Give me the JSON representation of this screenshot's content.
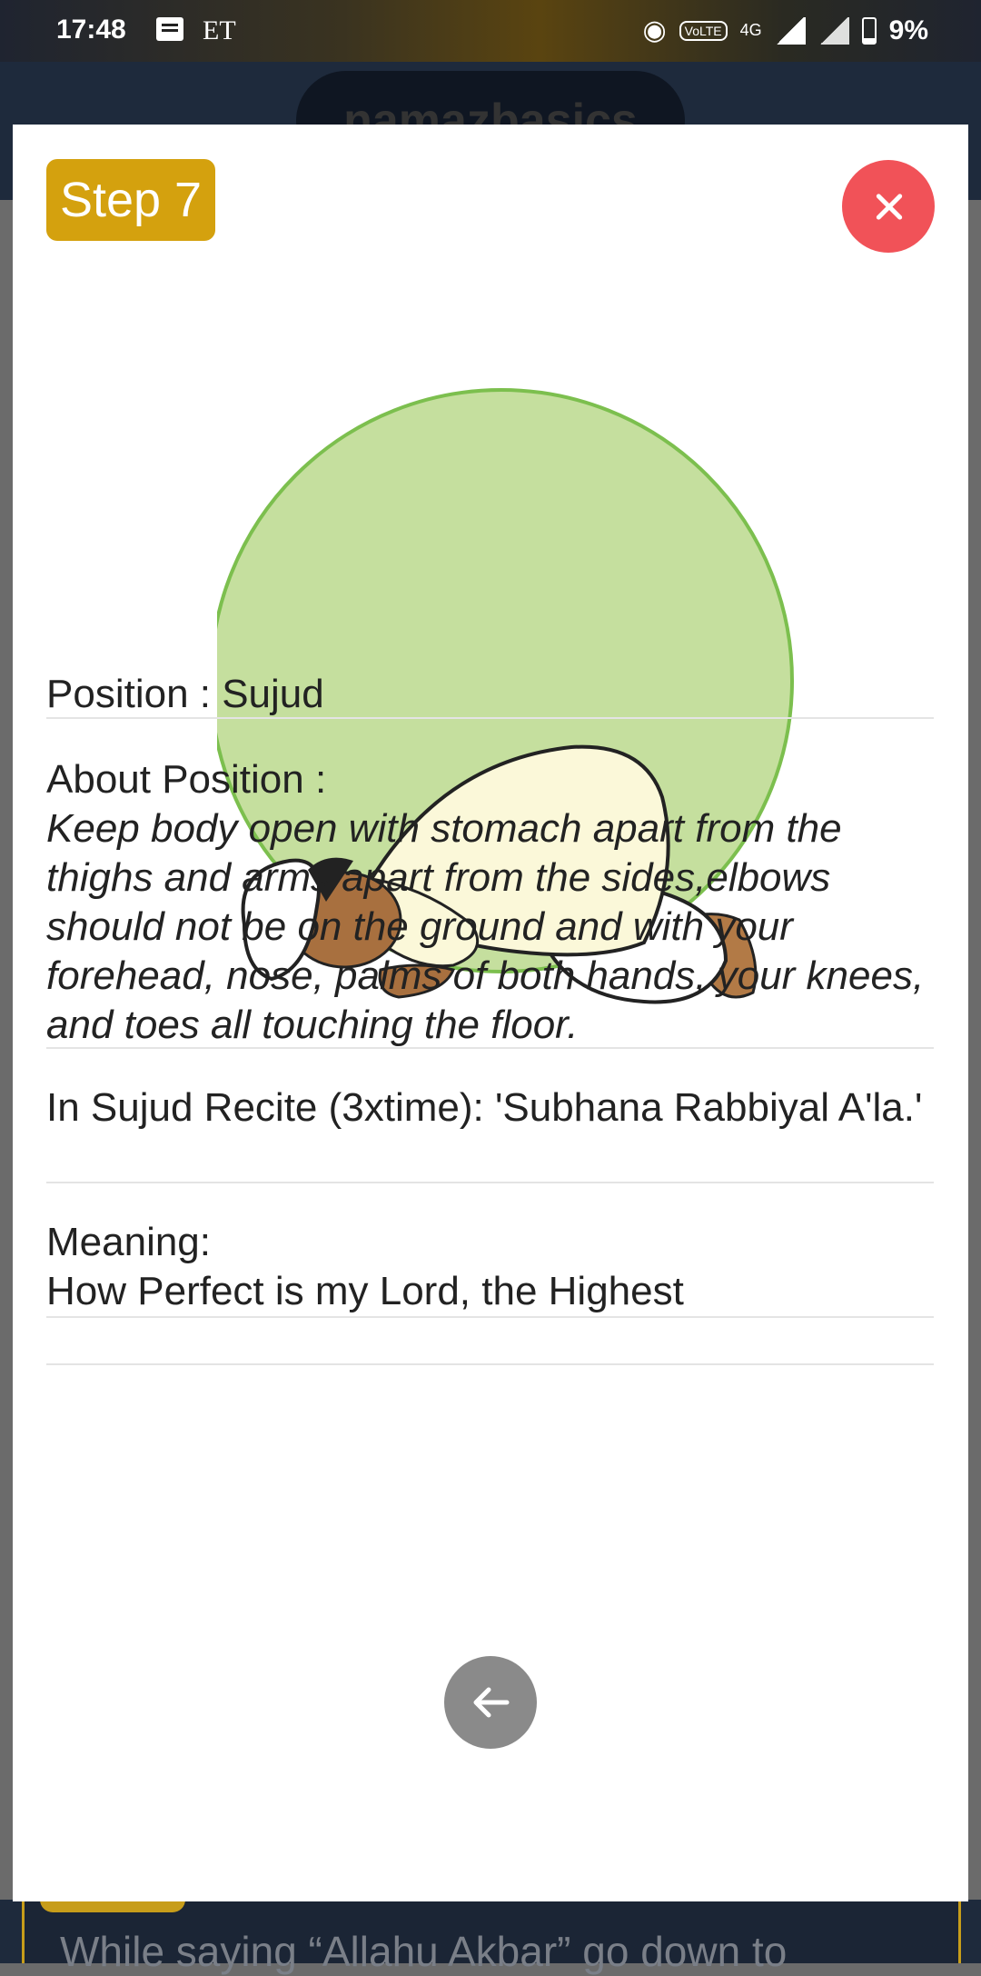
{
  "status_bar": {
    "time": "17:48",
    "carrier_label": "ET",
    "network": "4G",
    "volte": "VoLTE",
    "battery": "9%"
  },
  "app": {
    "title": "namazbasics",
    "bottom_text": "While saying “Allahu Akbar” go down to"
  },
  "modal": {
    "step_label": "Step 7",
    "illustration": "person-in-sujud-prayer-position",
    "position_line": "Position : Sujud",
    "about_heading": "About Position :",
    "about_text": "Keep body open with stomach apart from the thighs and arms apart from the sides,elbows should not be on the ground and with your forehead, nose, palms of both hands, your knees, and toes all touching the floor.",
    "recite_text": "In Sujud Recite (3xtime): 'Subhana Rabbiyal A'la.'",
    "meaning_heading": "Meaning:",
    "meaning_text": "How Perfect is my Lord, the Highest"
  },
  "colors": {
    "step_badge": "#d4a10e",
    "close_button": "#f15258",
    "circle_fill": "#c5df9e",
    "back_button": "#8a8a8a"
  }
}
